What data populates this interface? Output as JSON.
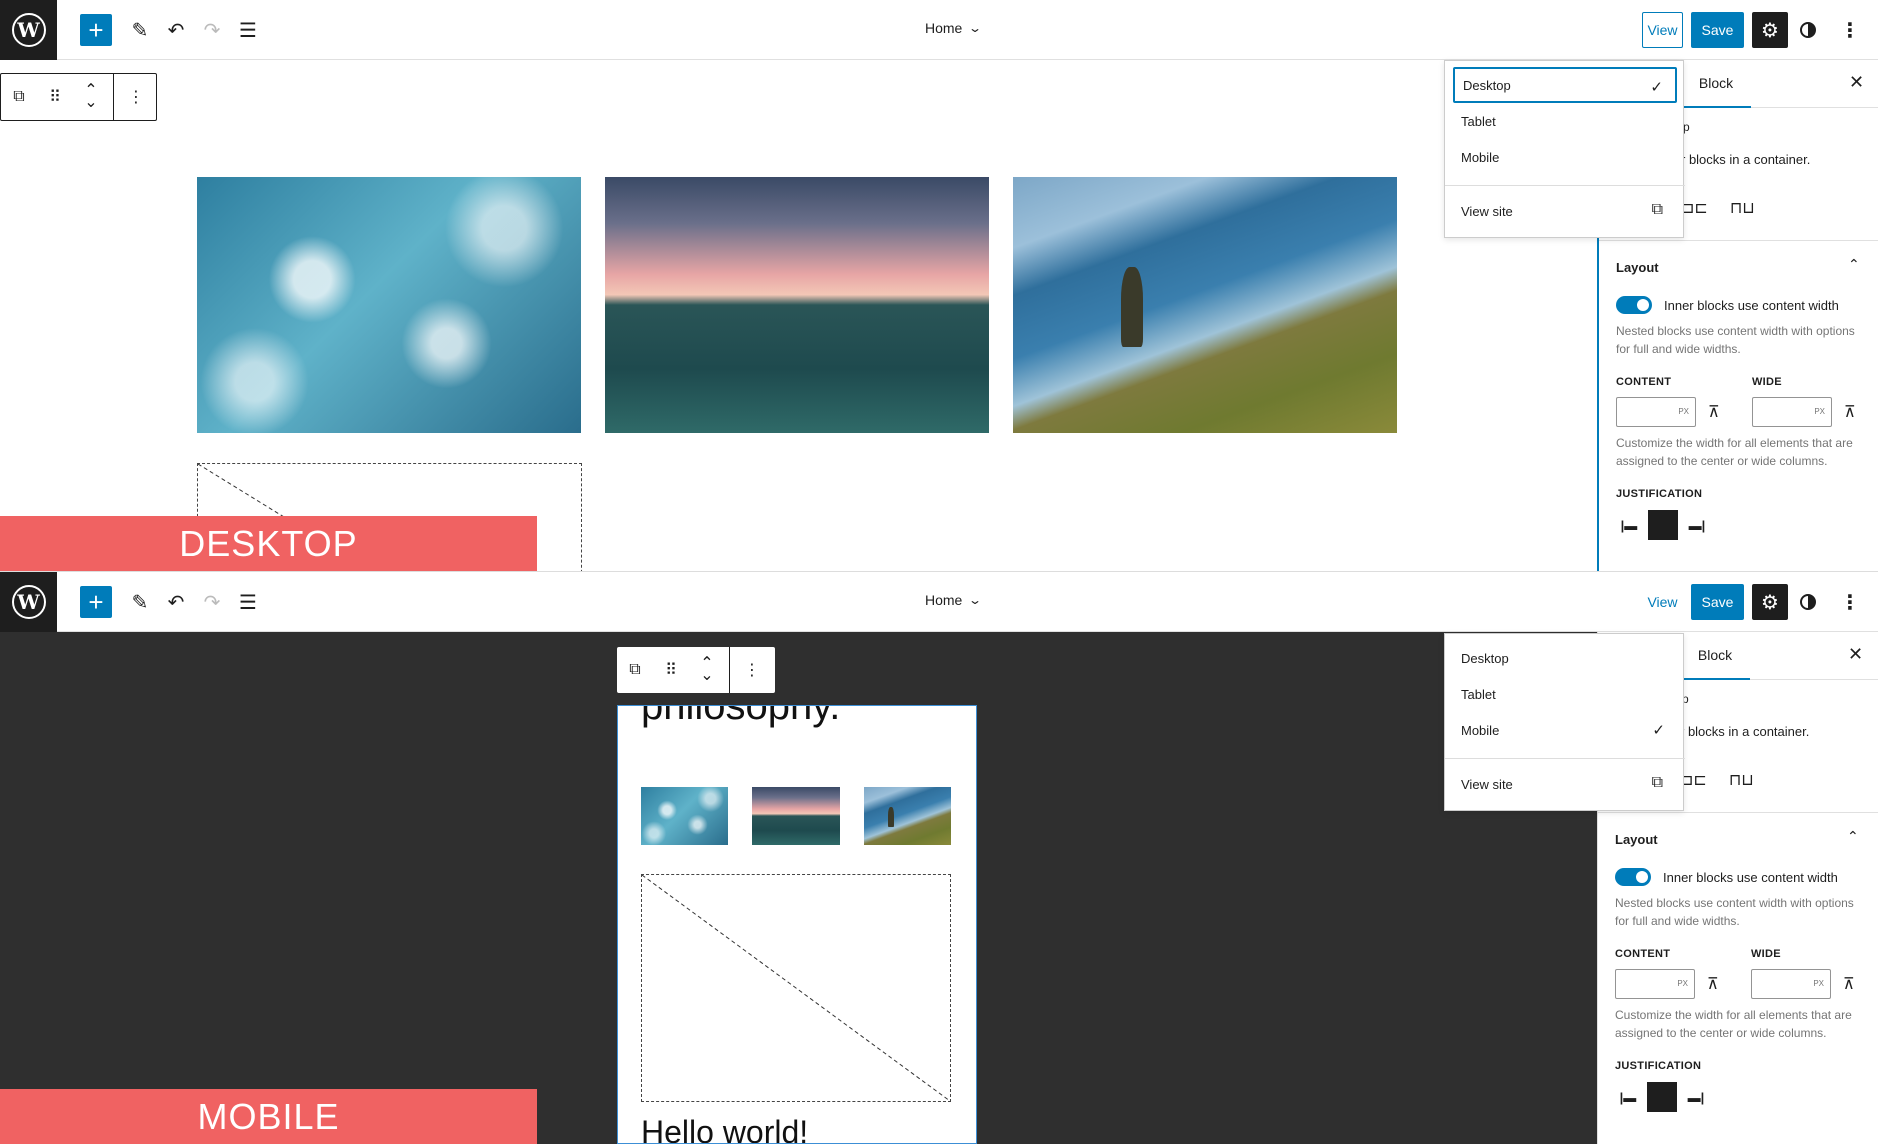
{
  "toolbar": {
    "logo_letter": "W",
    "add_symbol": "+",
    "document_title": "Home",
    "view_label": "View",
    "save_label": "Save"
  },
  "preview_menu": {
    "items": [
      {
        "label": "Desktop"
      },
      {
        "label": "Tablet"
      },
      {
        "label": "Mobile"
      }
    ],
    "view_site_label": "View site"
  },
  "views": {
    "desktop": {
      "banner": "DESKTOP",
      "selected_preview": "Desktop"
    },
    "mobile": {
      "banner": "MOBILE",
      "selected_preview": "Mobile",
      "heading_top": "philosophy.",
      "heading_bottom": "Hello world!"
    }
  },
  "sidebar": {
    "tab_block": "Block",
    "block_p_partial": "p",
    "block_desc_partial": "r blocks in a container.",
    "layout_title": "Layout",
    "toggle_label": "Inner blocks use content width",
    "toggle_on": true,
    "toggle_help": "Nested blocks use content width with options for full and wide widths.",
    "content_label": "CONTENT",
    "wide_label": "WIDE",
    "unit": "PX",
    "width_help": "Customize the width for all elements that are assigned to the center or wide columns.",
    "justification_label": "JUSTIFICATION"
  },
  "icons": {
    "add": "plus-icon",
    "edit": "pencil-icon",
    "undo": "undo-icon",
    "redo": "redo-icon",
    "list_view": "list-view-icon",
    "settings": "gear-icon",
    "styles": "contrast-icon",
    "options": "more-vertical-icon"
  },
  "colors": {
    "accent": "#007cba",
    "dark": "#1e1e1e",
    "banner": "#f06262",
    "canvas_dark": "#2f2f2f"
  }
}
